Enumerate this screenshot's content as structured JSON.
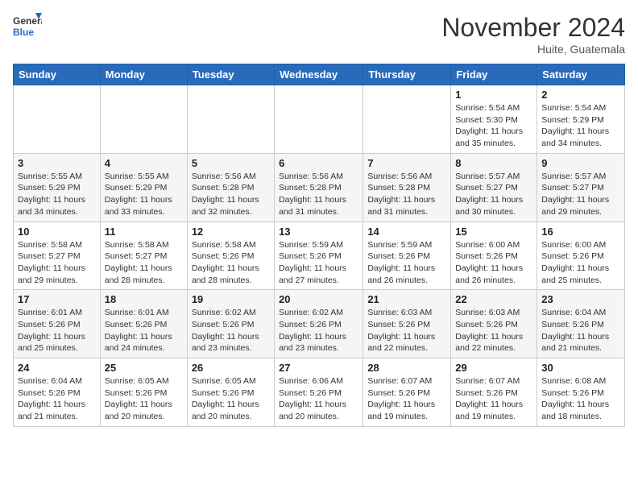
{
  "header": {
    "logo_general": "General",
    "logo_blue": "Blue",
    "month_title": "November 2024",
    "location": "Huite, Guatemala"
  },
  "days_of_week": [
    "Sunday",
    "Monday",
    "Tuesday",
    "Wednesday",
    "Thursday",
    "Friday",
    "Saturday"
  ],
  "weeks": [
    [
      {
        "day": "",
        "info": ""
      },
      {
        "day": "",
        "info": ""
      },
      {
        "day": "",
        "info": ""
      },
      {
        "day": "",
        "info": ""
      },
      {
        "day": "",
        "info": ""
      },
      {
        "day": "1",
        "info": "Sunrise: 5:54 AM\nSunset: 5:30 PM\nDaylight: 11 hours and 35 minutes."
      },
      {
        "day": "2",
        "info": "Sunrise: 5:54 AM\nSunset: 5:29 PM\nDaylight: 11 hours and 34 minutes."
      }
    ],
    [
      {
        "day": "3",
        "info": "Sunrise: 5:55 AM\nSunset: 5:29 PM\nDaylight: 11 hours and 34 minutes."
      },
      {
        "day": "4",
        "info": "Sunrise: 5:55 AM\nSunset: 5:29 PM\nDaylight: 11 hours and 33 minutes."
      },
      {
        "day": "5",
        "info": "Sunrise: 5:56 AM\nSunset: 5:28 PM\nDaylight: 11 hours and 32 minutes."
      },
      {
        "day": "6",
        "info": "Sunrise: 5:56 AM\nSunset: 5:28 PM\nDaylight: 11 hours and 31 minutes."
      },
      {
        "day": "7",
        "info": "Sunrise: 5:56 AM\nSunset: 5:28 PM\nDaylight: 11 hours and 31 minutes."
      },
      {
        "day": "8",
        "info": "Sunrise: 5:57 AM\nSunset: 5:27 PM\nDaylight: 11 hours and 30 minutes."
      },
      {
        "day": "9",
        "info": "Sunrise: 5:57 AM\nSunset: 5:27 PM\nDaylight: 11 hours and 29 minutes."
      }
    ],
    [
      {
        "day": "10",
        "info": "Sunrise: 5:58 AM\nSunset: 5:27 PM\nDaylight: 11 hours and 29 minutes."
      },
      {
        "day": "11",
        "info": "Sunrise: 5:58 AM\nSunset: 5:27 PM\nDaylight: 11 hours and 28 minutes."
      },
      {
        "day": "12",
        "info": "Sunrise: 5:58 AM\nSunset: 5:26 PM\nDaylight: 11 hours and 28 minutes."
      },
      {
        "day": "13",
        "info": "Sunrise: 5:59 AM\nSunset: 5:26 PM\nDaylight: 11 hours and 27 minutes."
      },
      {
        "day": "14",
        "info": "Sunrise: 5:59 AM\nSunset: 5:26 PM\nDaylight: 11 hours and 26 minutes."
      },
      {
        "day": "15",
        "info": "Sunrise: 6:00 AM\nSunset: 5:26 PM\nDaylight: 11 hours and 26 minutes."
      },
      {
        "day": "16",
        "info": "Sunrise: 6:00 AM\nSunset: 5:26 PM\nDaylight: 11 hours and 25 minutes."
      }
    ],
    [
      {
        "day": "17",
        "info": "Sunrise: 6:01 AM\nSunset: 5:26 PM\nDaylight: 11 hours and 25 minutes."
      },
      {
        "day": "18",
        "info": "Sunrise: 6:01 AM\nSunset: 5:26 PM\nDaylight: 11 hours and 24 minutes."
      },
      {
        "day": "19",
        "info": "Sunrise: 6:02 AM\nSunset: 5:26 PM\nDaylight: 11 hours and 23 minutes."
      },
      {
        "day": "20",
        "info": "Sunrise: 6:02 AM\nSunset: 5:26 PM\nDaylight: 11 hours and 23 minutes."
      },
      {
        "day": "21",
        "info": "Sunrise: 6:03 AM\nSunset: 5:26 PM\nDaylight: 11 hours and 22 minutes."
      },
      {
        "day": "22",
        "info": "Sunrise: 6:03 AM\nSunset: 5:26 PM\nDaylight: 11 hours and 22 minutes."
      },
      {
        "day": "23",
        "info": "Sunrise: 6:04 AM\nSunset: 5:26 PM\nDaylight: 11 hours and 21 minutes."
      }
    ],
    [
      {
        "day": "24",
        "info": "Sunrise: 6:04 AM\nSunset: 5:26 PM\nDaylight: 11 hours and 21 minutes."
      },
      {
        "day": "25",
        "info": "Sunrise: 6:05 AM\nSunset: 5:26 PM\nDaylight: 11 hours and 20 minutes."
      },
      {
        "day": "26",
        "info": "Sunrise: 6:05 AM\nSunset: 5:26 PM\nDaylight: 11 hours and 20 minutes."
      },
      {
        "day": "27",
        "info": "Sunrise: 6:06 AM\nSunset: 5:26 PM\nDaylight: 11 hours and 20 minutes."
      },
      {
        "day": "28",
        "info": "Sunrise: 6:07 AM\nSunset: 5:26 PM\nDaylight: 11 hours and 19 minutes."
      },
      {
        "day": "29",
        "info": "Sunrise: 6:07 AM\nSunset: 5:26 PM\nDaylight: 11 hours and 19 minutes."
      },
      {
        "day": "30",
        "info": "Sunrise: 6:08 AM\nSunset: 5:26 PM\nDaylight: 11 hours and 18 minutes."
      }
    ]
  ]
}
